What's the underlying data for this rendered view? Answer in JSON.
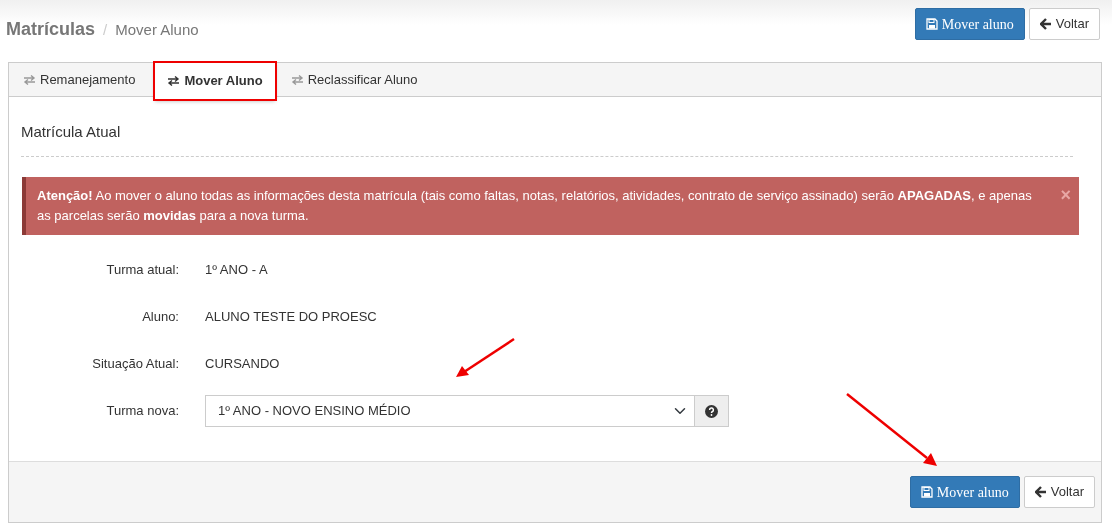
{
  "breadcrumb": {
    "title": "Matrículas",
    "separator": "/",
    "current": "Mover Aluno"
  },
  "header_buttons": [
    {
      "kind": "save",
      "label": "Mover aluno"
    },
    {
      "kind": "back",
      "label": "Voltar"
    }
  ],
  "tabs": [
    {
      "label": "Remanejamento",
      "selected": false
    },
    {
      "label": "Mover Aluno",
      "selected": true
    },
    {
      "label": "Reclassificar Aluno",
      "selected": false
    }
  ],
  "section_title": "Matrícula Atual",
  "alert": {
    "text": "**Atenção!** Ao mover o aluno todas as informações desta matrícula (tais como faltas, notas, relatórios, atividades, contrato de serviço assinado) serão **APAGADAS**, e apenas as parcelas serão **movidas** para a nova turma.",
    "close": "×"
  },
  "fields": [
    {
      "kind": "text",
      "label": "Turma atual:",
      "value": "1º ANO - A"
    },
    {
      "kind": "text",
      "label": "Aluno:",
      "value": "ALUNO TESTE DO PROESC"
    },
    {
      "kind": "text",
      "label": "Situação Atual:",
      "value": "CURSANDO"
    },
    {
      "kind": "select",
      "label": "Turma nova:",
      "value": "1º ANO - NOVO ENSINO MÉDIO"
    }
  ],
  "footer_buttons": [
    {
      "kind": "save",
      "label": "Mover aluno"
    },
    {
      "kind": "back",
      "label": "Voltar"
    }
  ]
}
